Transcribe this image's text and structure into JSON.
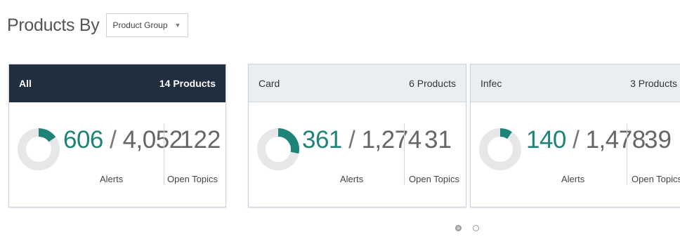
{
  "header": {
    "title": "Products By",
    "group_select": {
      "selected": "Product Group"
    }
  },
  "colors": {
    "accent": "#1f8478",
    "donut_track": "#e5e7e8",
    "dark_header": "#1f2f3f",
    "light_header": "#ebeef1"
  },
  "cards": [
    {
      "name": "All",
      "products": "14 Products",
      "alerts": "606",
      "total": "4,052",
      "alerts_label": "Alerts",
      "topics": "122",
      "topics_label": "Open Topics",
      "donut_fraction": 0.15
    },
    {
      "name": "Card",
      "products": "6 Products",
      "alerts": "361",
      "total": "1,274",
      "alerts_label": "Alerts",
      "topics": "31",
      "topics_label": "Open Topics",
      "donut_fraction": 0.283
    },
    {
      "name": "Infec",
      "products": "3 Products",
      "alerts": "140",
      "total": "1,478",
      "alerts_label": "Alerts",
      "topics": "39",
      "topics_label": "Open Topics",
      "donut_fraction": 0.095
    }
  ],
  "pagination": {
    "pages": 2,
    "current": 1
  }
}
